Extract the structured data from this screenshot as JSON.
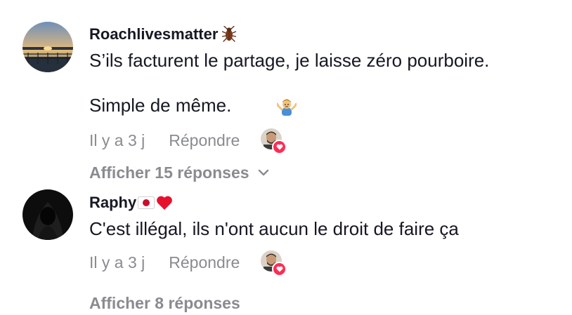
{
  "comments": [
    {
      "username": "Roachlivesmatter",
      "username_decoration": "cockroach-emoji",
      "text_line1": "S’ils facturent le partage, je laisse zéro pourboire.",
      "text_line2": "Simple de même.",
      "text_emoji": "person-shrugging-emoji",
      "time": "Il y a 3 j",
      "reply_label": "Répondre",
      "liked_by_creator": true,
      "view_replies_label": "Afficher 15 réponses"
    },
    {
      "username": "Raphy",
      "username_decoration": "japan-flag-and-red-heart-emoji",
      "text_line1": "C'est illégal, ils n'ont aucun le droit de faire ça",
      "time": "Il y a 3 j",
      "reply_label": "Répondre",
      "liked_by_creator": true,
      "view_replies_label": "Afficher 8 réponses"
    }
  ],
  "colors": {
    "primary_text": "#161823",
    "secondary_text": "#8a8b91",
    "like_heart": "#fe2c55"
  }
}
